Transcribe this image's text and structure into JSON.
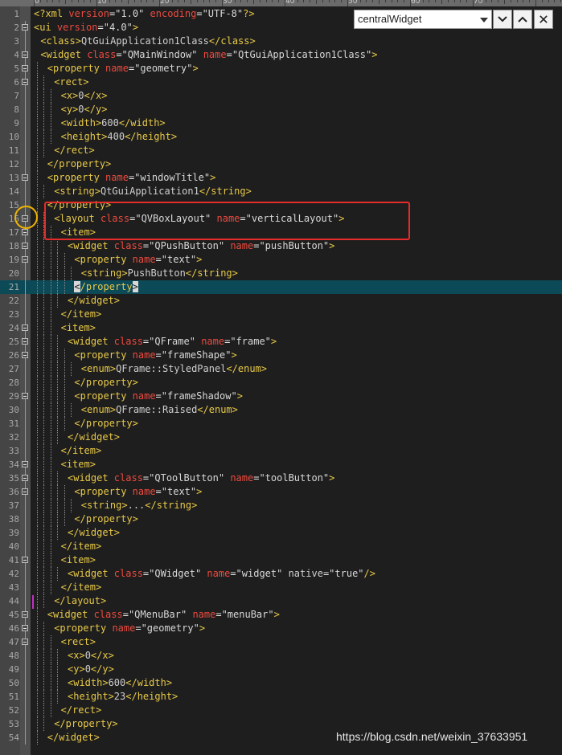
{
  "ruler": {
    "labels": [
      "0",
      "10",
      "20",
      "30",
      "40",
      "50",
      "60",
      "70"
    ]
  },
  "toolbar": {
    "scope_value": "centralWidget"
  },
  "editor": {
    "highlight_line": 21,
    "lines": [
      {
        "n": "1",
        "fold": false,
        "depth": 0,
        "parts": [
          [
            "t",
            "<?xml "
          ],
          [
            "a",
            "version"
          ],
          [
            "x",
            "="
          ],
          [
            "v",
            "\"1.0\" "
          ],
          [
            "a",
            "encoding"
          ],
          [
            "x",
            "="
          ],
          [
            "v",
            "\"UTF-8\""
          ],
          [
            "t",
            "?>"
          ]
        ]
      },
      {
        "n": "2",
        "fold": true,
        "depth": 0,
        "parts": [
          [
            "t",
            "<ui "
          ],
          [
            "a",
            "version"
          ],
          [
            "x",
            "="
          ],
          [
            "v",
            "\"4.0\""
          ],
          [
            "t",
            ">"
          ]
        ]
      },
      {
        "n": "3",
        "fold": false,
        "depth": 1,
        "parts": [
          [
            "t",
            "<class>"
          ],
          [
            "s",
            "QtGuiApplication1Class"
          ],
          [
            "t",
            "</class>"
          ]
        ]
      },
      {
        "n": "4",
        "fold": true,
        "depth": 1,
        "parts": [
          [
            "t",
            "<widget "
          ],
          [
            "a",
            "class"
          ],
          [
            "x",
            "="
          ],
          [
            "v",
            "\"QMainWindow\" "
          ],
          [
            "a",
            "name"
          ],
          [
            "x",
            "="
          ],
          [
            "v",
            "\"QtGuiApplication1Class\""
          ],
          [
            "t",
            ">"
          ]
        ]
      },
      {
        "n": "5",
        "fold": true,
        "depth": 2,
        "parts": [
          [
            "t",
            "<property "
          ],
          [
            "a",
            "name"
          ],
          [
            "x",
            "="
          ],
          [
            "v",
            "\"geometry\""
          ],
          [
            "t",
            ">"
          ]
        ]
      },
      {
        "n": "6",
        "fold": true,
        "depth": 3,
        "parts": [
          [
            "t",
            "<rect>"
          ]
        ]
      },
      {
        "n": "7",
        "fold": false,
        "depth": 4,
        "parts": [
          [
            "t",
            "<x>"
          ],
          [
            "s",
            "0"
          ],
          [
            "t",
            "</x>"
          ]
        ]
      },
      {
        "n": "8",
        "fold": false,
        "depth": 4,
        "parts": [
          [
            "t",
            "<y>"
          ],
          [
            "s",
            "0"
          ],
          [
            "t",
            "</y>"
          ]
        ]
      },
      {
        "n": "9",
        "fold": false,
        "depth": 4,
        "parts": [
          [
            "t",
            "<width>"
          ],
          [
            "s",
            "600"
          ],
          [
            "t",
            "</width>"
          ]
        ]
      },
      {
        "n": "10",
        "fold": false,
        "depth": 4,
        "parts": [
          [
            "t",
            "<height>"
          ],
          [
            "s",
            "400"
          ],
          [
            "t",
            "</height>"
          ]
        ]
      },
      {
        "n": "11",
        "fold": false,
        "depth": 3,
        "parts": [
          [
            "t",
            "</rect>"
          ]
        ]
      },
      {
        "n": "12",
        "fold": false,
        "depth": 2,
        "parts": [
          [
            "t",
            "</property>"
          ]
        ]
      },
      {
        "n": "13",
        "fold": true,
        "depth": 2,
        "parts": [
          [
            "t",
            "<property "
          ],
          [
            "a",
            "name"
          ],
          [
            "x",
            "="
          ],
          [
            "v",
            "\"windowTitle\""
          ],
          [
            "t",
            ">"
          ]
        ]
      },
      {
        "n": "14",
        "fold": false,
        "depth": 3,
        "parts": [
          [
            "t",
            "<string>"
          ],
          [
            "s",
            "QtGuiApplication1"
          ],
          [
            "t",
            "</string>"
          ]
        ]
      },
      {
        "n": "15",
        "fold": false,
        "depth": 2,
        "parts": [
          [
            "t",
            "</property>"
          ]
        ]
      },
      {
        "n": "16",
        "fold": true,
        "depth": 3,
        "parts": [
          [
            "t",
            "<layout "
          ],
          [
            "a",
            "class"
          ],
          [
            "x",
            "="
          ],
          [
            "v",
            "\"QVBoxLayout\" "
          ],
          [
            "a",
            "name"
          ],
          [
            "x",
            "="
          ],
          [
            "v",
            "\"verticalLayout\""
          ],
          [
            "t",
            ">"
          ]
        ]
      },
      {
        "n": "17",
        "fold": true,
        "depth": 4,
        "parts": [
          [
            "t",
            "<item>"
          ]
        ]
      },
      {
        "n": "18",
        "fold": true,
        "depth": 5,
        "parts": [
          [
            "t",
            "<widget "
          ],
          [
            "a",
            "class"
          ],
          [
            "x",
            "="
          ],
          [
            "v",
            "\"QPushButton\" "
          ],
          [
            "a",
            "name"
          ],
          [
            "x",
            "="
          ],
          [
            "v",
            "\"pushButton\""
          ],
          [
            "t",
            ">"
          ]
        ]
      },
      {
        "n": "19",
        "fold": true,
        "depth": 6,
        "parts": [
          [
            "t",
            "<property "
          ],
          [
            "a",
            "name"
          ],
          [
            "x",
            "="
          ],
          [
            "v",
            "\"text\""
          ],
          [
            "t",
            ">"
          ]
        ]
      },
      {
        "n": "20",
        "fold": false,
        "depth": 7,
        "parts": [
          [
            "t",
            "<string>"
          ],
          [
            "s",
            "PushButton"
          ],
          [
            "t",
            "</string>"
          ]
        ]
      },
      {
        "n": "21",
        "fold": false,
        "depth": 6,
        "parts": [
          [
            "caret",
            "<"
          ],
          [
            "t",
            "/property"
          ],
          [
            "caret",
            ">"
          ]
        ]
      },
      {
        "n": "22",
        "fold": false,
        "depth": 5,
        "parts": [
          [
            "t",
            "</widget>"
          ]
        ]
      },
      {
        "n": "23",
        "fold": false,
        "depth": 4,
        "parts": [
          [
            "t",
            "</item>"
          ]
        ]
      },
      {
        "n": "24",
        "fold": true,
        "depth": 4,
        "parts": [
          [
            "t",
            "<item>"
          ]
        ]
      },
      {
        "n": "25",
        "fold": true,
        "depth": 5,
        "parts": [
          [
            "t",
            "<widget "
          ],
          [
            "a",
            "class"
          ],
          [
            "x",
            "="
          ],
          [
            "v",
            "\"QFrame\" "
          ],
          [
            "a",
            "name"
          ],
          [
            "x",
            "="
          ],
          [
            "v",
            "\"frame\""
          ],
          [
            "t",
            ">"
          ]
        ]
      },
      {
        "n": "26",
        "fold": true,
        "depth": 6,
        "parts": [
          [
            "t",
            "<property "
          ],
          [
            "a",
            "name"
          ],
          [
            "x",
            "="
          ],
          [
            "v",
            "\"frameShape\""
          ],
          [
            "t",
            ">"
          ]
        ]
      },
      {
        "n": "27",
        "fold": false,
        "depth": 7,
        "parts": [
          [
            "t",
            "<enum>"
          ],
          [
            "s",
            "QFrame::StyledPanel"
          ],
          [
            "t",
            "</enum>"
          ]
        ]
      },
      {
        "n": "28",
        "fold": false,
        "depth": 6,
        "parts": [
          [
            "t",
            "</property>"
          ]
        ]
      },
      {
        "n": "29",
        "fold": true,
        "depth": 6,
        "parts": [
          [
            "t",
            "<property "
          ],
          [
            "a",
            "name"
          ],
          [
            "x",
            "="
          ],
          [
            "v",
            "\"frameShadow\""
          ],
          [
            "t",
            ">"
          ]
        ]
      },
      {
        "n": "30",
        "fold": false,
        "depth": 7,
        "parts": [
          [
            "t",
            "<enum>"
          ],
          [
            "s",
            "QFrame::Raised"
          ],
          [
            "t",
            "</enum>"
          ]
        ]
      },
      {
        "n": "31",
        "fold": false,
        "depth": 6,
        "parts": [
          [
            "t",
            "</property>"
          ]
        ]
      },
      {
        "n": "32",
        "fold": false,
        "depth": 5,
        "parts": [
          [
            "t",
            "</widget>"
          ]
        ]
      },
      {
        "n": "33",
        "fold": false,
        "depth": 4,
        "parts": [
          [
            "t",
            "</item>"
          ]
        ]
      },
      {
        "n": "34",
        "fold": true,
        "depth": 4,
        "parts": [
          [
            "t",
            "<item>"
          ]
        ]
      },
      {
        "n": "35",
        "fold": true,
        "depth": 5,
        "parts": [
          [
            "t",
            "<widget "
          ],
          [
            "a",
            "class"
          ],
          [
            "x",
            "="
          ],
          [
            "v",
            "\"QToolButton\" "
          ],
          [
            "a",
            "name"
          ],
          [
            "x",
            "="
          ],
          [
            "v",
            "\"toolButton\""
          ],
          [
            "t",
            ">"
          ]
        ]
      },
      {
        "n": "36",
        "fold": true,
        "depth": 6,
        "parts": [
          [
            "t",
            "<property "
          ],
          [
            "a",
            "name"
          ],
          [
            "x",
            "="
          ],
          [
            "v",
            "\"text\""
          ],
          [
            "t",
            ">"
          ]
        ]
      },
      {
        "n": "37",
        "fold": false,
        "depth": 7,
        "parts": [
          [
            "t",
            "<string>"
          ],
          [
            "s",
            "..."
          ],
          [
            "t",
            "</string>"
          ]
        ]
      },
      {
        "n": "38",
        "fold": false,
        "depth": 6,
        "parts": [
          [
            "t",
            "</property>"
          ]
        ]
      },
      {
        "n": "39",
        "fold": false,
        "depth": 5,
        "parts": [
          [
            "t",
            "</widget>"
          ]
        ]
      },
      {
        "n": "40",
        "fold": false,
        "depth": 4,
        "parts": [
          [
            "t",
            "</item>"
          ]
        ]
      },
      {
        "n": "41",
        "fold": true,
        "depth": 4,
        "parts": [
          [
            "t",
            "<item>"
          ]
        ]
      },
      {
        "n": "42",
        "fold": false,
        "depth": 5,
        "parts": [
          [
            "t",
            "<widget "
          ],
          [
            "a",
            "class"
          ],
          [
            "x",
            "="
          ],
          [
            "v",
            "\"QWidget\" "
          ],
          [
            "a",
            "name"
          ],
          [
            "x",
            "="
          ],
          [
            "v",
            "\"widget\" "
          ],
          [
            "s",
            "native"
          ],
          [
            "x",
            "="
          ],
          [
            "v",
            "\"true\""
          ],
          [
            "t",
            "/>"
          ]
        ]
      },
      {
        "n": "43",
        "fold": false,
        "depth": 4,
        "parts": [
          [
            "t",
            "</item>"
          ]
        ]
      },
      {
        "n": "44",
        "fold": false,
        "depth": 3,
        "parts": [
          [
            "t",
            "</layout>"
          ]
        ]
      },
      {
        "n": "45",
        "fold": true,
        "depth": 2,
        "parts": [
          [
            "t",
            "<widget "
          ],
          [
            "a",
            "class"
          ],
          [
            "x",
            "="
          ],
          [
            "v",
            "\"QMenuBar\" "
          ],
          [
            "a",
            "name"
          ],
          [
            "x",
            "="
          ],
          [
            "v",
            "\"menuBar\""
          ],
          [
            "t",
            ">"
          ]
        ]
      },
      {
        "n": "46",
        "fold": true,
        "depth": 3,
        "parts": [
          [
            "t",
            "<property "
          ],
          [
            "a",
            "name"
          ],
          [
            "x",
            "="
          ],
          [
            "v",
            "\"geometry\""
          ],
          [
            "t",
            ">"
          ]
        ]
      },
      {
        "n": "47",
        "fold": true,
        "depth": 4,
        "parts": [
          [
            "t",
            "<rect>"
          ]
        ]
      },
      {
        "n": "48",
        "fold": false,
        "depth": 5,
        "parts": [
          [
            "t",
            "<x>"
          ],
          [
            "s",
            "0"
          ],
          [
            "t",
            "</x>"
          ]
        ]
      },
      {
        "n": "49",
        "fold": false,
        "depth": 5,
        "parts": [
          [
            "t",
            "<y>"
          ],
          [
            "s",
            "0"
          ],
          [
            "t",
            "</y>"
          ]
        ]
      },
      {
        "n": "50",
        "fold": false,
        "depth": 5,
        "parts": [
          [
            "t",
            "<width>"
          ],
          [
            "s",
            "600"
          ],
          [
            "t",
            "</width>"
          ]
        ]
      },
      {
        "n": "51",
        "fold": false,
        "depth": 5,
        "parts": [
          [
            "t",
            "<height>"
          ],
          [
            "s",
            "23"
          ],
          [
            "t",
            "</height>"
          ]
        ]
      },
      {
        "n": "52",
        "fold": false,
        "depth": 4,
        "parts": [
          [
            "t",
            "</rect>"
          ]
        ]
      },
      {
        "n": "53",
        "fold": false,
        "depth": 3,
        "parts": [
          [
            "t",
            "</property>"
          ]
        ]
      },
      {
        "n": "54",
        "fold": false,
        "depth": 2,
        "parts": [
          [
            "t",
            "</widget>"
          ]
        ]
      }
    ]
  },
  "watermark": "https://blog.csdn.net/weixin_37633951",
  "colors": {
    "tag": "#e8c948",
    "attribute": "#ec4a3f",
    "value": "#d8d8d8",
    "highlight_line_bg": "#0d4a58",
    "annotation_box": "#e62b2b",
    "annotation_circle": "#f0b400"
  },
  "icons": {
    "combo_arrow": "chevron-down-icon",
    "nav_next": "chevron-down-icon",
    "nav_prev": "chevron-up-icon",
    "nav_close": "close-icon"
  }
}
